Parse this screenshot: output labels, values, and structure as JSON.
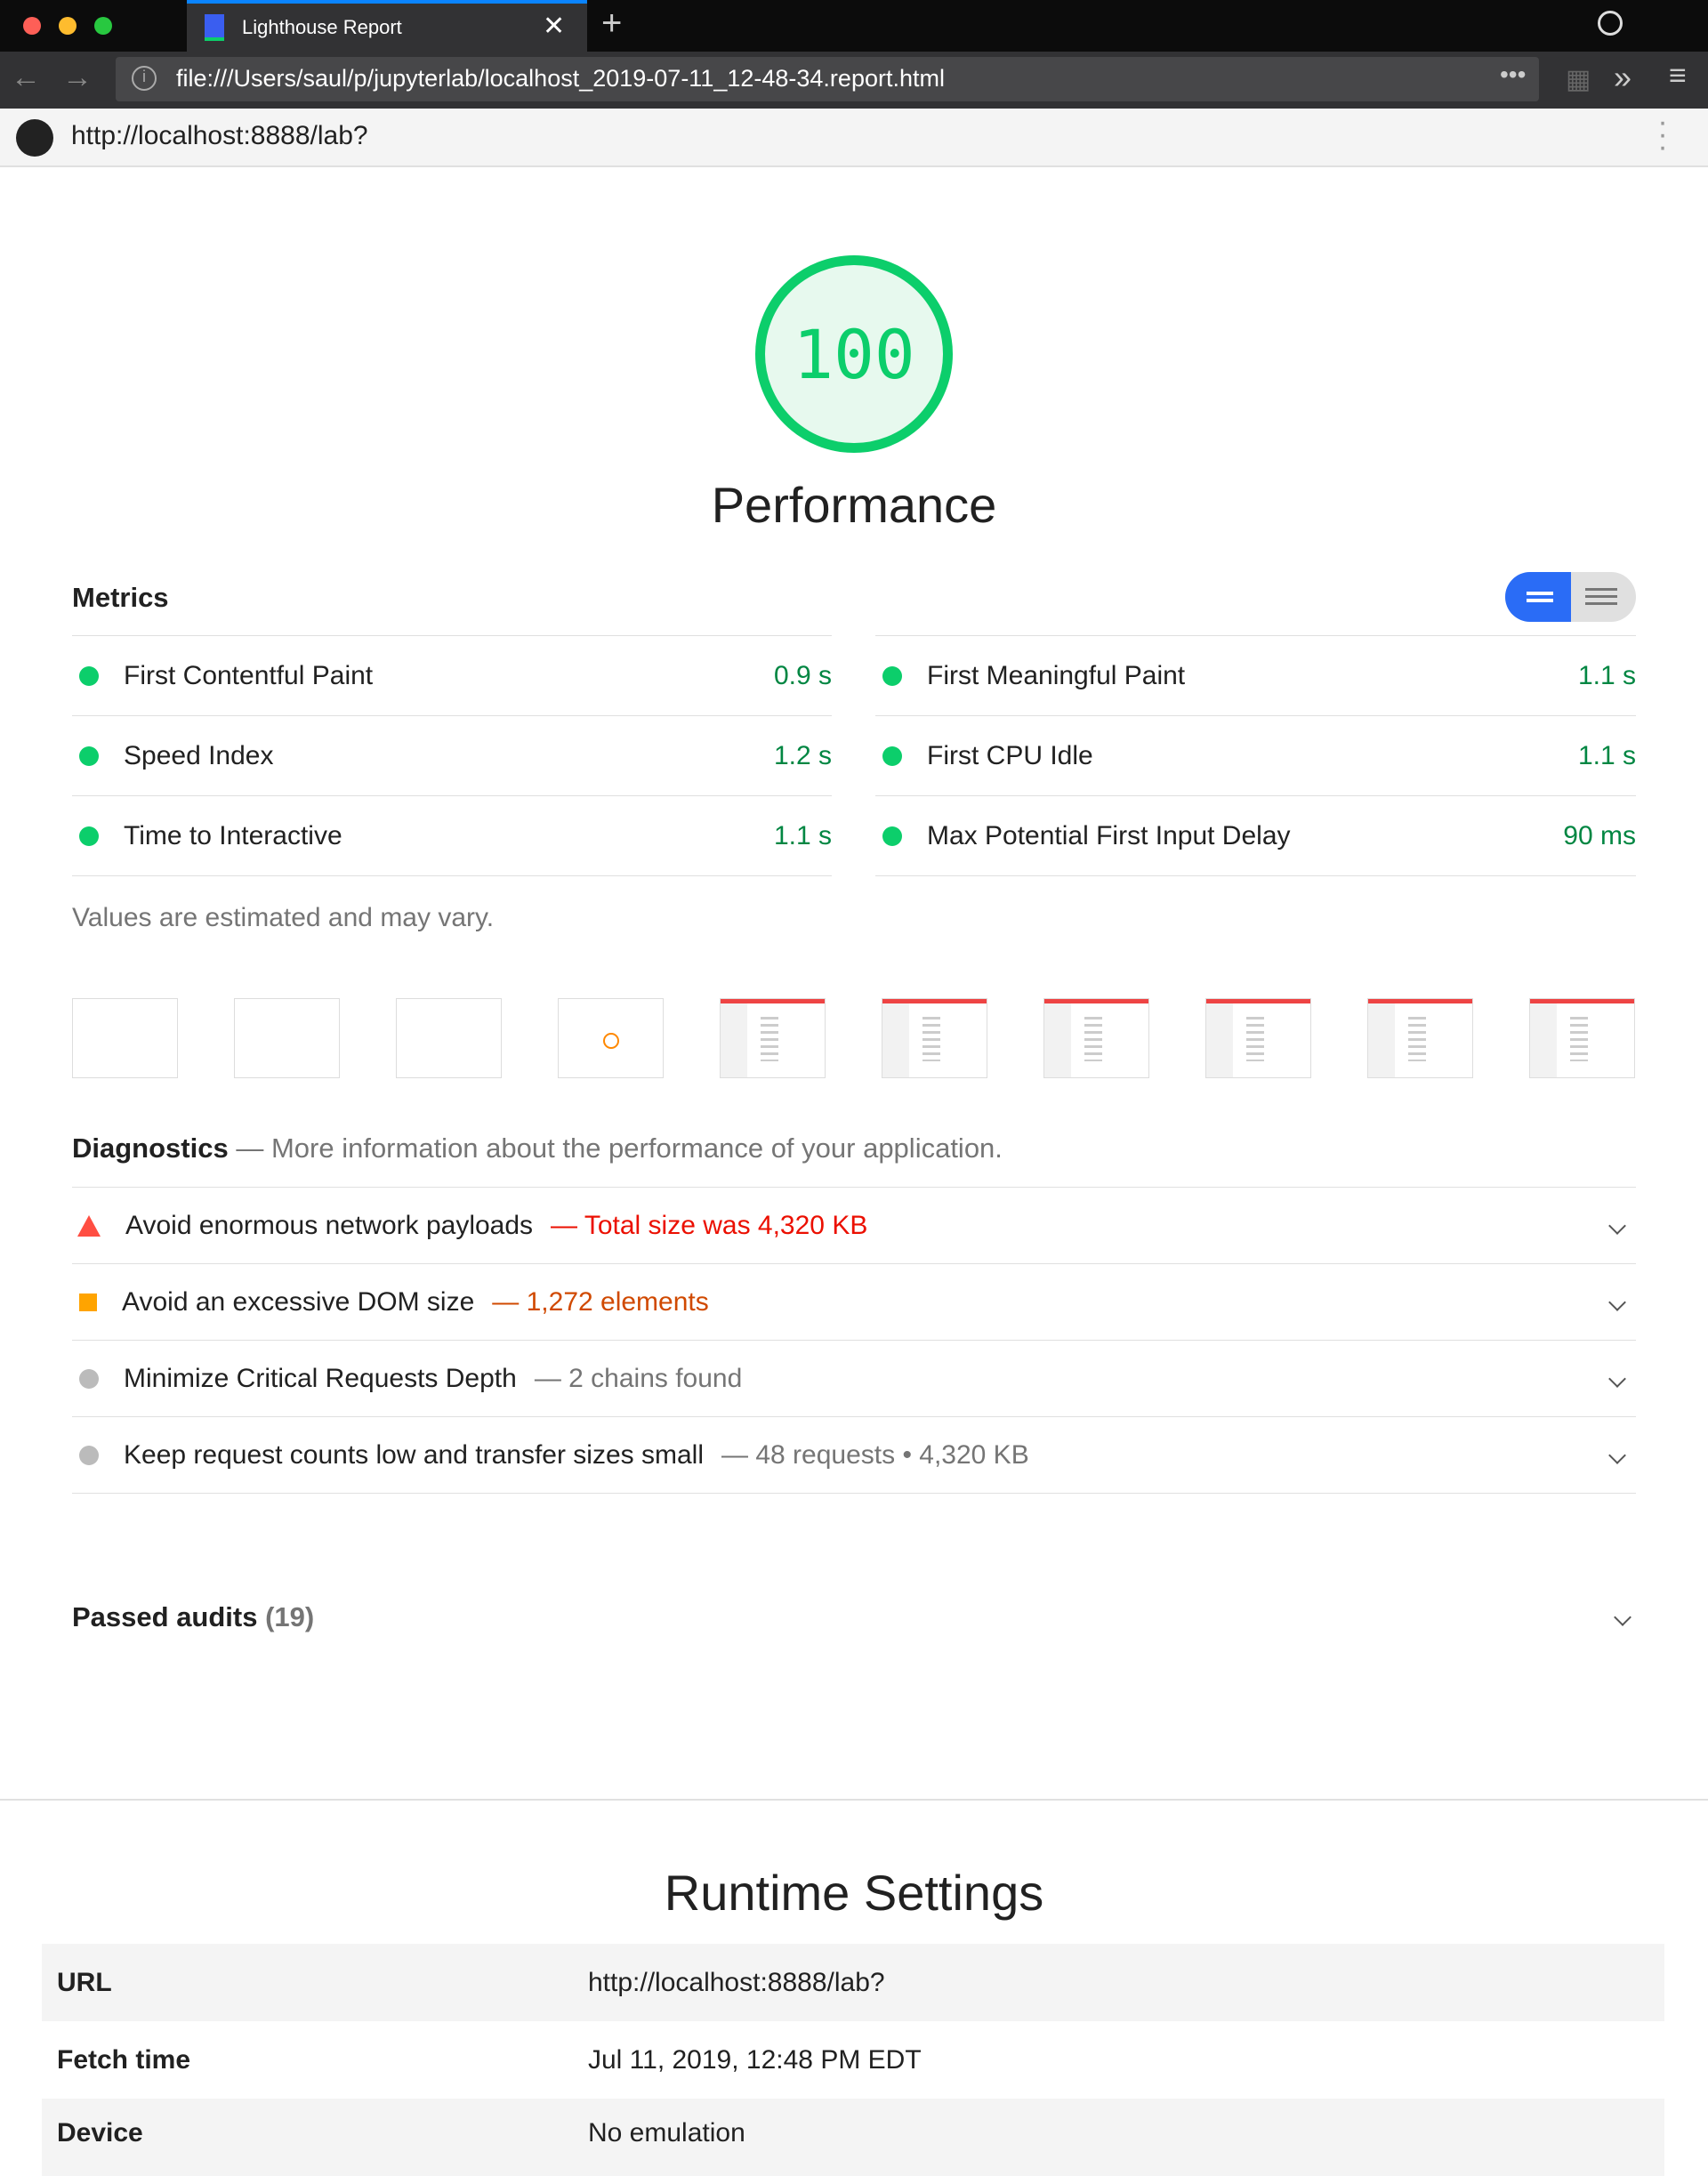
{
  "browser": {
    "tab_title": "Lighthouse Report",
    "address": "file:///Users/saul/p/jupyterlab/localhost_2019-07-11_12-48-34.report.html",
    "page_url": "http://localhost:8888/lab?"
  },
  "score": {
    "value": "100",
    "label": "Performance",
    "fraction": 1.0,
    "color": "#0cce6b"
  },
  "metrics": {
    "title": "Metrics",
    "items": [
      {
        "label": "First Contentful Paint",
        "value": "0.9 s"
      },
      {
        "label": "First Meaningful Paint",
        "value": "1.1 s"
      },
      {
        "label": "Speed Index",
        "value": "1.2 s"
      },
      {
        "label": "First CPU Idle",
        "value": "1.1 s"
      },
      {
        "label": "Time to Interactive",
        "value": "1.1 s"
      },
      {
        "label": "Max Potential First Input Delay",
        "value": "90 ms"
      }
    ],
    "note": "Values are estimated and may vary."
  },
  "diagnostics": {
    "title": "Diagnostics",
    "subtitle": "— More information about the performance of your application.",
    "items": [
      {
        "label": "Avoid enormous network payloads",
        "detail": "— Total size was 4,320 KB",
        "status": "fail"
      },
      {
        "label": "Avoid an excessive DOM size",
        "detail": "— 1,272 elements",
        "status": "average"
      },
      {
        "label": "Minimize Critical Requests Depth",
        "detail": "— 2 chains found",
        "status": "info"
      },
      {
        "label": "Keep request counts low and transfer sizes small",
        "detail": "— 48 requests • 4,320 KB",
        "status": "info"
      }
    ]
  },
  "passed": {
    "label": "Passed audits",
    "count": "(19)"
  },
  "runtime": {
    "title": "Runtime Settings",
    "rows": [
      {
        "key": "URL",
        "value": "http://localhost:8888/lab?"
      },
      {
        "key": "Fetch time",
        "value": "Jul 11, 2019, 12:48 PM EDT"
      },
      {
        "key": "Device",
        "value": "No emulation"
      }
    ]
  }
}
